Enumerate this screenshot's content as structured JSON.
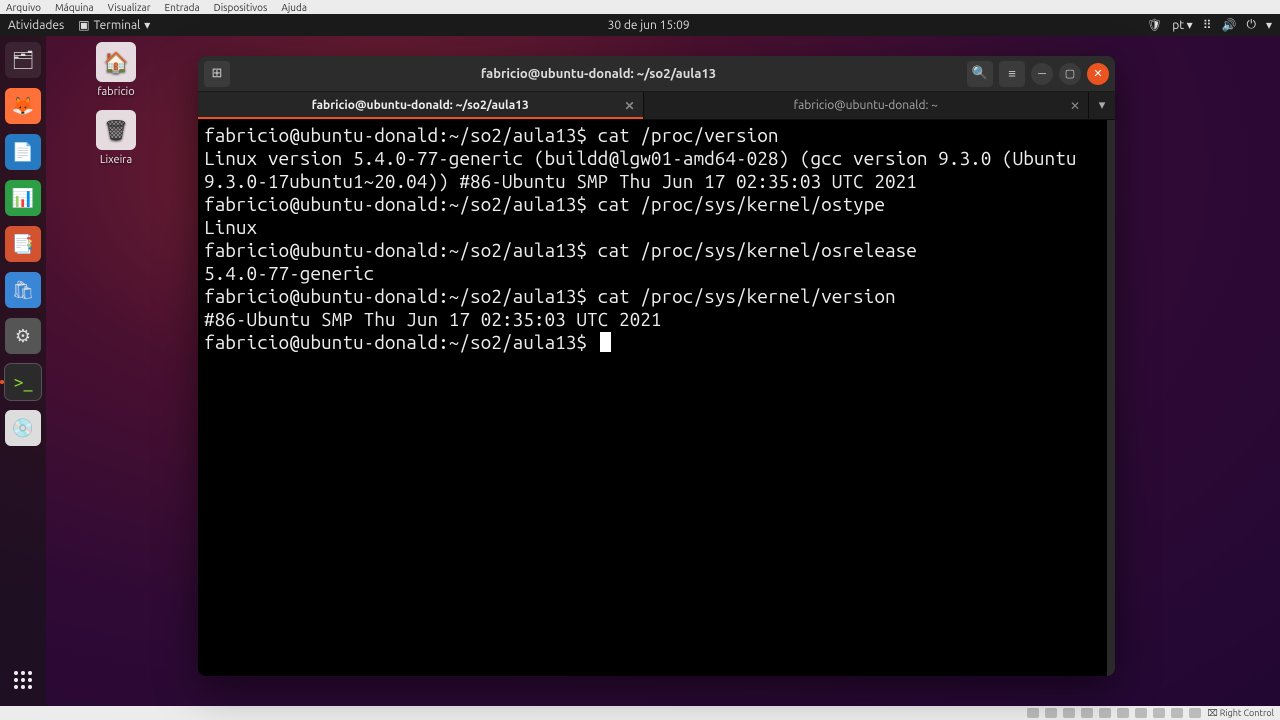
{
  "virtualbox": {
    "menu": [
      "Arquivo",
      "Máquina",
      "Visualizar",
      "Entrada",
      "Dispositivos",
      "Ajuda"
    ],
    "host_key": "Right Control"
  },
  "gnome": {
    "activities": "Atividades",
    "app_name": "Terminal",
    "datetime": "30 de jun  15:09",
    "lang": "pt"
  },
  "desktop_icons": {
    "home": "fabricio",
    "trash": "Lixeira"
  },
  "dock": {
    "apps": [
      "files",
      "firefox",
      "document",
      "spreadsheet",
      "presentation",
      "software",
      "settings",
      "terminal",
      "disc"
    ]
  },
  "terminal": {
    "title": "fabricio@ubuntu-donald: ~/so2/aula13",
    "tabs": [
      {
        "label": "fabricio@ubuntu-donald: ~/so2/aula13",
        "active": true
      },
      {
        "label": "fabricio@ubuntu-donald: ~",
        "active": false
      }
    ],
    "prompt": "fabricio@ubuntu-donald:~/so2/aula13$",
    "session": [
      {
        "cmd": "cat /proc/version",
        "out": "Linux version 5.4.0-77-generic (buildd@lgw01-amd64-028) (gcc version 9.3.0 (Ubuntu 9.3.0-17ubuntu1~20.04)) #86-Ubuntu SMP Thu Jun 17 02:35:03 UTC 2021"
      },
      {
        "cmd": "cat /proc/sys/kernel/ostype",
        "out": "Linux"
      },
      {
        "cmd": "cat /proc/sys/kernel/osrelease",
        "out": "5.4.0-77-generic"
      },
      {
        "cmd": "cat /proc/sys/kernel/version",
        "out": "#86-Ubuntu SMP Thu Jun 17 02:35:03 UTC 2021"
      }
    ]
  }
}
